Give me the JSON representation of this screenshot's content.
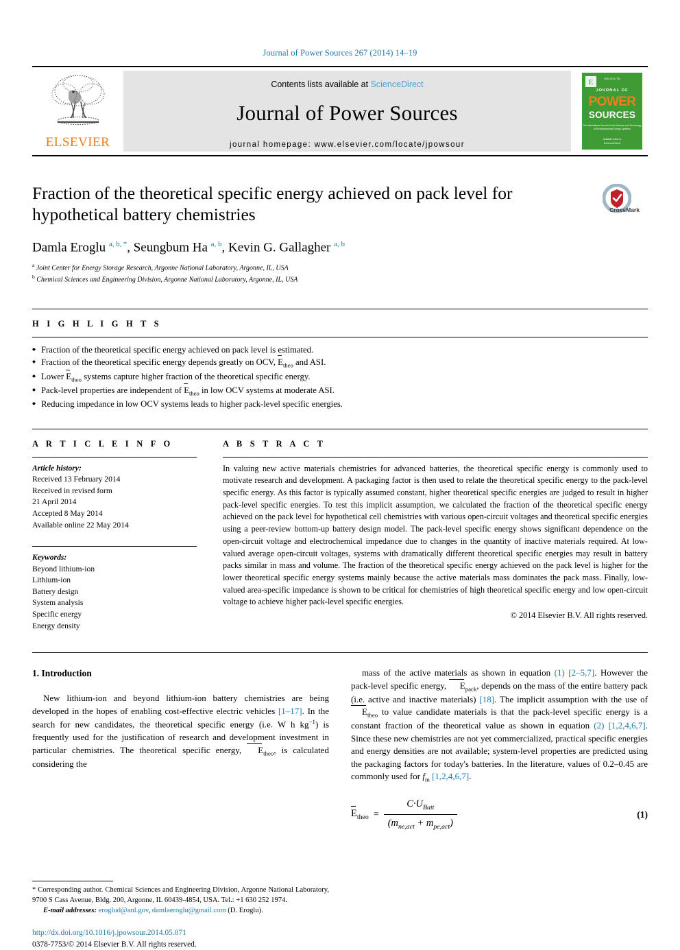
{
  "running_head": "Journal of Power Sources 267 (2014) 14–19",
  "masthead": {
    "contents_prefix": "Contents lists available at ",
    "sciencedirect": "ScienceDirect",
    "journal_title": "Journal of Power Sources",
    "homepage": "journal homepage: www.elsevier.com/locate/jpowsour",
    "publisher_wordmark": "ELSEVIER",
    "publisher_logo_icon": "elsevier-tree-logo",
    "cover_icon": "journal-cover-thumbnail",
    "cover_title_line1": "JOURNAL OF",
    "cover_title_line2": "POWER",
    "cover_title_line3": "SOURCES",
    "accent_link_color": "#4aa3d4",
    "brand_orange": "#ef7c19",
    "cover_green": "#3f9c35"
  },
  "article": {
    "title": "Fraction of the theoretical specific energy achieved on pack level for hypothetical battery chemistries",
    "crossmark_label": "CrossMark",
    "authors_html": "Damla Eroglu <sup>a, b, *</sup>, Seungbum Ha <sup>a, b</sup>, Kevin G. Gallagher <sup>a, b</sup>",
    "affiliations": [
      {
        "marker": "a",
        "text": "Joint Center for Energy Storage Research, Argonne National Laboratory, Argonne, IL, USA"
      },
      {
        "marker": "b",
        "text": "Chemical Sciences and Engineering Division, Argonne National Laboratory, Argonne, IL, USA"
      }
    ]
  },
  "highlights": {
    "heading": "H I G H L I G H T S",
    "items_html": [
      "Fraction of the theoretical specific energy achieved on pack level is estimated.",
      "Fraction of the theoretical specific energy depends greatly on OCV, <span class=\"ovl\">E</span><sub>theo</sub> and ASI.",
      "Lower <span class=\"ovl\">E</span><sub>theo</sub> systems capture higher fraction of the theoretical specific energy.",
      "Pack-level properties are independent of <span class=\"ovl\">E</span><sub>theo</sub> in low OCV systems at moderate ASI.",
      "Reducing impedance in low OCV systems leads to higher pack-level specific energies."
    ]
  },
  "article_info": {
    "heading": "A R T I C L E  I N F O",
    "history_label": "Article history:",
    "history_lines": [
      "Received 13 February 2014",
      "Received in revised form",
      "21 April 2014",
      "Accepted 8 May 2014",
      "Available online 22 May 2014"
    ],
    "keywords_label": "Keywords:",
    "keywords": [
      "Beyond lithium-ion",
      "Lithium-ion",
      "Battery design",
      "System analysis",
      "Specific energy",
      "Energy density"
    ]
  },
  "abstract": {
    "heading": "A B S T R A C T",
    "text": "In valuing new active materials chemistries for advanced batteries, the theoretical specific energy is commonly used to motivate research and development. A packaging factor is then used to relate the theoretical specific energy to the pack-level specific energy. As this factor is typically assumed constant, higher theoretical specific energies are judged to result in higher pack-level specific energies. To test this implicit assumption, we calculated the fraction of the theoretical specific energy achieved on the pack level for hypothetical cell chemistries with various open-circuit voltages and theoretical specific energies using a peer-review bottom-up battery design model. The pack-level specific energy shows significant dependence on the open-circuit voltage and electrochemical impedance due to changes in the quantity of inactive materials required. At low-valued average open-circuit voltages, systems with dramatically different theoretical specific energies may result in battery packs similar in mass and volume. The fraction of the theoretical specific energy achieved on the pack level is higher for the lower theoretical specific energy systems mainly because the active materials mass dominates the pack mass. Finally, low-valued area-specific impedance is shown to be critical for chemistries of high theoretical specific energy and low open-circuit voltage to achieve higher pack-level specific energies.",
    "copyright": "© 2014 Elsevier B.V. All rights reserved."
  },
  "introduction": {
    "section_number_title": "1.  Introduction",
    "left_para_html": "New lithium-ion and beyond lithium-ion battery chemistries are being developed in the hopes of enabling cost-effective electric vehicles <span class=\"ref\">[1–17]</span>. In the search for new candidates, the theoretical specific energy (i.e. W h kg<sup>−1</sup>) is frequently used for the justification of research and development investment in particular chemistries. The theoretical specific energy, <span class=\"ovl\">E</span><sub>theo</sub>, is calculated considering the",
    "right_para_html": "mass of the active materials as shown in equation <span class=\"ref\">(1)</span> <span class=\"ref\">[2–5,7]</span>. However the pack-level specific energy, <span class=\"ovl\">E</span><sub>pack</sub>, depends on the mass of the entire battery pack (i.e. active and inactive materials) <span class=\"ref\">[18]</span>. The implicit assumption with the use of <span class=\"ovl\">E</span><sub>theo</sub> to value candidate materials is that the pack-level specific energy is a constant fraction of the theoretical value as shown in equation <span class=\"ref\">(2)</span> <span class=\"ref\">[1,2,4,6,7]</span>. Since these new chemistries are not yet commercialized, practical specific energies and energy densities are not available; system-level properties are predicted using the packaging factors for today's batteries. In the literature, values of 0.2–0.45 are commonly used for <i>f</i><sub>m</sub> <span class=\"ref\">[1,2,4,6,7]</span>."
  },
  "equation": {
    "lhs_html": "<span class=\"ovl\">E</span><sub>theo</sub>",
    "equals": "=",
    "numerator_html": "C·U<sub>Batt</sub>",
    "denominator_html": "(m<sub>ne,act</sub> + m<sub>pe,act</sub>)",
    "number": "(1)"
  },
  "footnote": {
    "corresponding_html": "* Corresponding author. Chemical Sciences and Engineering Division, Argonne National Laboratory, 9700 S Cass Avenue, Bldg. 200, Argonne, IL 60439-4854, USA. Tel.: +1 630 252 1974.",
    "email_label": "E-mail addresses:",
    "email_1": "eroglud@anl.gov",
    "email_2": "damlaeroglu@gmail.com",
    "email_suffix": "(D. Eroglu)."
  },
  "footer": {
    "doi": "http://dx.doi.org/10.1016/j.jpowsour.2014.05.071",
    "issn_html": "0378-7753/© 2014 Elsevier B.V. All rights reserved."
  }
}
